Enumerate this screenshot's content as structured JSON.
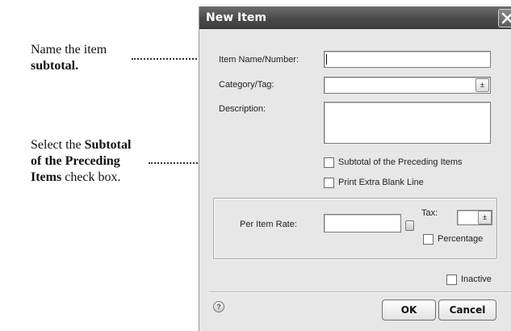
{
  "callouts": [
    {
      "line1": "Name the item",
      "line2_bold": "subtotal."
    },
    {
      "line1_plain": "Select the ",
      "line1_bold": "Subtotal",
      "line2_bold": "of the Preceding",
      "line3_bold": "Items",
      "line3_plain": " check box."
    }
  ],
  "dialog": {
    "title": "New Item",
    "close_icon": "close-x-icon",
    "fields": {
      "item_name": {
        "label": "Item Name/Number:",
        "value": ""
      },
      "category": {
        "label": "Category/Tag:",
        "value": ""
      },
      "description": {
        "label": "Description:",
        "value": ""
      }
    },
    "checkboxes": {
      "subtotal": {
        "label": "Subtotal of the Preceding Items",
        "checked": false
      },
      "blank_line": {
        "label": "Print Extra Blank Line",
        "checked": false
      },
      "percentage": {
        "label": "Percentage",
        "checked": false
      },
      "inactive": {
        "label": "Inactive",
        "checked": false
      }
    },
    "rate": {
      "label": "Per Item Rate:",
      "value": ""
    },
    "tax": {
      "label": "Tax:",
      "value": ""
    },
    "buttons": {
      "ok": "OK",
      "cancel": "Cancel"
    },
    "help_glyph": "?",
    "dropdown_glyph": "±"
  }
}
